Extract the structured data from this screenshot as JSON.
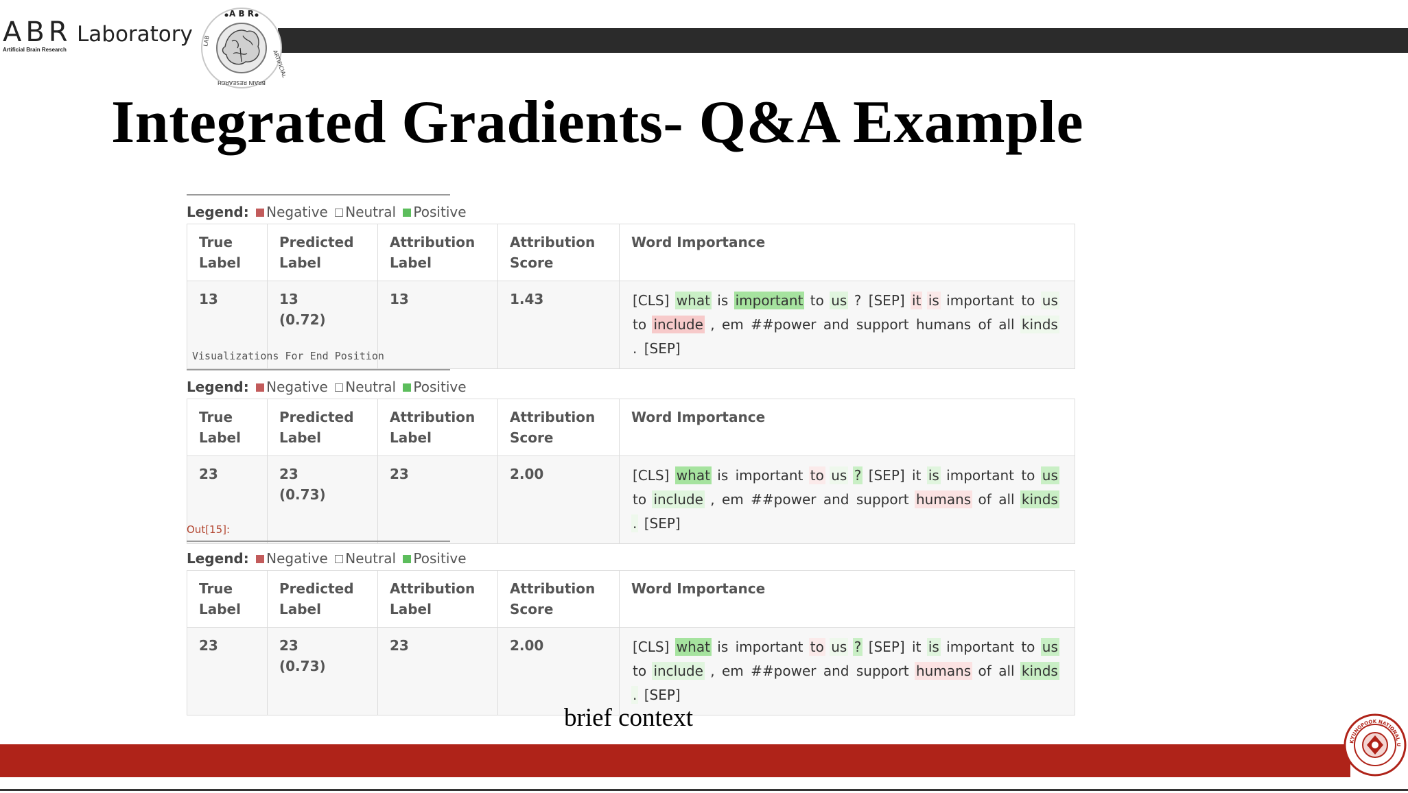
{
  "header": {
    "lab_abr": "ABR",
    "lab_name": "Laboratory",
    "lab_subtitle": "Artificial Brain Research",
    "seal_text": "ABR • ARTIFICIAL BRAIN RESEARCH LAB"
  },
  "title": "Integrated Gradients- Q&A Example",
  "legend": {
    "label": "Legend:",
    "negative": "Negative",
    "neutral": "Neutral",
    "positive": "Positive"
  },
  "columns": [
    "True Label",
    "Predicted Label",
    "Attribution Label",
    "Attribution Score",
    "Word Importance"
  ],
  "captions": {
    "end_position": "Visualizations For End Position",
    "out": "Out[15]:"
  },
  "visualizations": [
    {
      "true_label": "13",
      "predicted_label": "13",
      "predicted_prob": "(0.72)",
      "attribution_label": "13",
      "attribution_score": "1.43",
      "tokens": [
        "[CLS]",
        "what",
        "is",
        "important",
        "to",
        "us",
        "?",
        "[SEP]",
        "it",
        "is",
        "important",
        "to",
        "us",
        "to",
        "include",
        ",",
        "em",
        "##power",
        "and",
        "support",
        "humans",
        "of",
        "all",
        "kinds",
        ".",
        "[SEP]"
      ],
      "colors": [
        "#ffffff",
        "#c9efc5",
        "#ffffff",
        "#a6e39f",
        "#ffffff",
        "#e0f5de",
        "#ffffff",
        "#ffffff",
        "#fbe2e2",
        "#fbe9e9",
        "#ffffff",
        "#ffffff",
        "#eef8ec",
        "#ffffff",
        "#f7caca",
        "#ffffff",
        "#ffffff",
        "#ffffff",
        "#ffffff",
        "#ffffff",
        "#ffffff",
        "#ffffff",
        "#ffffff",
        "#eef8ec",
        "#ffffff",
        "#ffffff"
      ]
    },
    {
      "true_label": "23",
      "predicted_label": "23",
      "predicted_prob": "(0.73)",
      "attribution_label": "23",
      "attribution_score": "2.00",
      "tokens": [
        "[CLS]",
        "what",
        "is",
        "important",
        "to",
        "us",
        "?",
        "[SEP]",
        "it",
        "is",
        "important",
        "to",
        "us",
        "to",
        "include",
        ",",
        "em",
        "##power",
        "and",
        "support",
        "humans",
        "of",
        "all",
        "kinds",
        ".",
        "[SEP]"
      ],
      "colors": [
        "#ffffff",
        "#a6e39f",
        "#ffffff",
        "#ffffff",
        "#fbeaea",
        "#eef8ec",
        "#c9efc5",
        "#ffffff",
        "#ffffff",
        "#e0f5de",
        "#ffffff",
        "#ffffff",
        "#c9efc5",
        "#ffffff",
        "#e0f5de",
        "#ffffff",
        "#ffffff",
        "#ffffff",
        "#ffffff",
        "#ffffff",
        "#fbe2e2",
        "#ffffff",
        "#ffffff",
        "#c9efc5",
        "#eef8ec",
        "#ffffff"
      ]
    },
    {
      "true_label": "23",
      "predicted_label": "23",
      "predicted_prob": "(0.73)",
      "attribution_label": "23",
      "attribution_score": "2.00",
      "tokens": [
        "[CLS]",
        "what",
        "is",
        "important",
        "to",
        "us",
        "?",
        "[SEP]",
        "it",
        "is",
        "important",
        "to",
        "us",
        "to",
        "include",
        ",",
        "em",
        "##power",
        "and",
        "support",
        "humans",
        "of",
        "all",
        "kinds",
        ".",
        "[SEP]"
      ],
      "colors": [
        "#ffffff",
        "#a6e39f",
        "#ffffff",
        "#ffffff",
        "#fbeaea",
        "#eef8ec",
        "#c9efc5",
        "#ffffff",
        "#ffffff",
        "#e0f5de",
        "#ffffff",
        "#ffffff",
        "#c9efc5",
        "#ffffff",
        "#e0f5de",
        "#ffffff",
        "#ffffff",
        "#ffffff",
        "#ffffff",
        "#ffffff",
        "#fbe2e2",
        "#ffffff",
        "#ffffff",
        "#c9efc5",
        "#eef8ec",
        "#ffffff"
      ]
    }
  ],
  "footer": {
    "brief": "brief context",
    "university_seal_text": "KYUNGPOOK NATIONAL UNIVERSITY"
  },
  "colors": {
    "header_bar": "#2b2b2b",
    "footer_bar": "#af2319",
    "negative": "#c25b5b",
    "positive": "#5cbd5c"
  }
}
